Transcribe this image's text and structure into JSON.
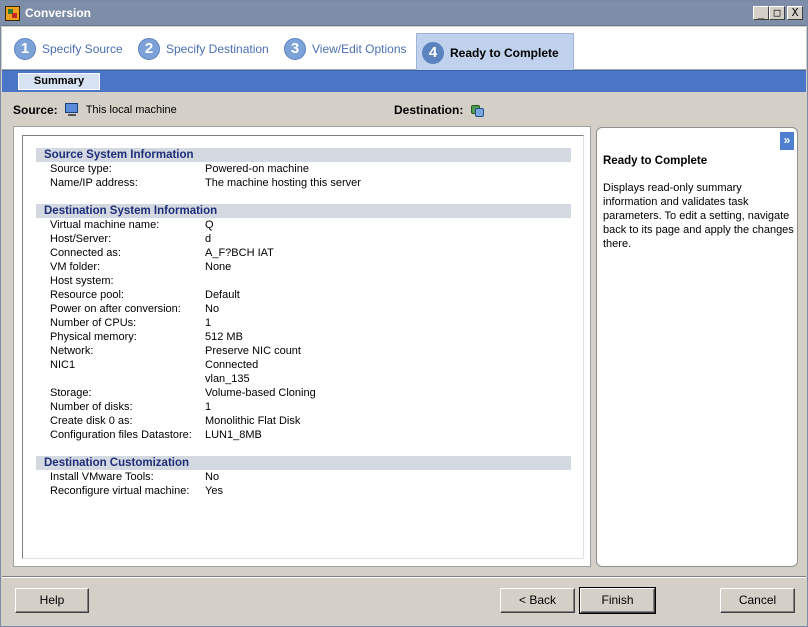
{
  "window": {
    "title": "Conversion",
    "controls": {
      "minimize": "_",
      "maximize": "□",
      "close": "X"
    }
  },
  "steps": [
    {
      "num": "1",
      "label": "Specify Source"
    },
    {
      "num": "2",
      "label": "Specify Destination"
    },
    {
      "num": "3",
      "label": "View/Edit Options"
    },
    {
      "num": "4",
      "label": "Ready to Complete",
      "active": true
    }
  ],
  "subtab": {
    "label": "Summary"
  },
  "source_line": {
    "source_label": "Source:",
    "source_value": "This local machine",
    "destination_label": "Destination:"
  },
  "summary": {
    "sections": [
      {
        "title": "Source System Information",
        "rows": [
          {
            "k": "Source type:",
            "v": "Powered-on machine"
          },
          {
            "k": "Name/IP address:",
            "v": "The machine hosting this server"
          }
        ]
      },
      {
        "title": "Destination System Information",
        "rows": [
          {
            "k": "Virtual machine name:",
            "v": "Q"
          },
          {
            "k": "Host/Server:",
            "v": "d"
          },
          {
            "k": "Connected as:",
            "v": "A_F?BCH IAT"
          },
          {
            "k": "VM folder:",
            "v": "None"
          },
          {
            "k": "Host system:",
            "v": ""
          },
          {
            "k": "Resource pool:",
            "v": "Default"
          },
          {
            "k": "Power on after conversion:",
            "v": "No"
          },
          {
            "k": "Number of CPUs:",
            "v": "1"
          },
          {
            "k": "Physical memory:",
            "v": "512 MB"
          },
          {
            "k": "Network:",
            "v": "Preserve NIC count"
          },
          {
            "k": "NIC1",
            "v": "Connected"
          },
          {
            "k": "",
            "v": "vlan_135"
          },
          {
            "k": "Storage:",
            "v": "Volume-based Cloning"
          },
          {
            "k": "Number of disks:",
            "v": "1"
          },
          {
            "k": "Create disk 0 as:",
            "v": "Monolithic Flat Disk"
          },
          {
            "k": "Configuration files Datastore:",
            "v": "LUN1_8MB"
          }
        ]
      },
      {
        "title": "Destination Customization",
        "rows": [
          {
            "k": "Install VMware Tools:",
            "v": "No"
          },
          {
            "k": "Reconfigure virtual machine:",
            "v": "Yes"
          }
        ]
      }
    ]
  },
  "help": {
    "expand": "»",
    "title": "Ready to Complete",
    "body": "Displays read-only summary information and validates task parameters. To edit a setting, navigate back to its page and apply the changes there."
  },
  "buttons": {
    "help": "Help",
    "back": "< Back",
    "finish": "Finish",
    "cancel": "Cancel"
  }
}
